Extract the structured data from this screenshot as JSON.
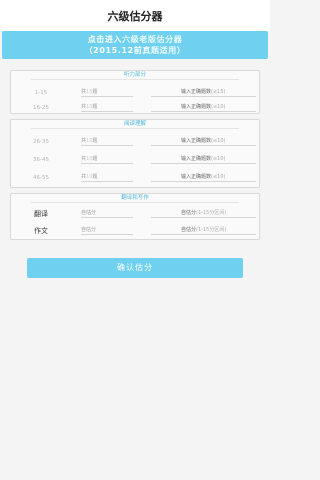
{
  "header": {
    "title": "六级估分器"
  },
  "banner": {
    "line1_highlight": "点击进入",
    "line1_plain": "六级老版估分器",
    "line2_open": "（",
    "line2_year": "2015.12前",
    "line2_plain": "真题适用",
    "line2_close": "）"
  },
  "listening": {
    "title": "听力部分",
    "rows": [
      {
        "range": "1-15",
        "count_prefix": "共",
        "count": "15",
        "count_suffix": "题",
        "input_label": "输入正确题数",
        "max": "(≤15)"
      },
      {
        "range": "16-25",
        "count_prefix": "共",
        "count": "10",
        "count_suffix": "题",
        "input_label": "输入正确题数",
        "max": "(≤10)"
      }
    ]
  },
  "reading": {
    "title": "阅读理解",
    "rows": [
      {
        "range": "26-35",
        "count_prefix": "共",
        "count": "10",
        "count_suffix": "题",
        "input_label": "输入正确题数",
        "max": "(≤10)"
      },
      {
        "range": "36-45",
        "count_prefix": "共",
        "count": "10",
        "count_suffix": "题",
        "input_label": "输入正确题数",
        "max": "(≤10)"
      },
      {
        "range": "46-55",
        "count_prefix": "共",
        "count": "10",
        "count_suffix": "题",
        "input_label": "输入正确题数",
        "max": "(≤10)"
      }
    ]
  },
  "writing": {
    "title": "翻译和写作",
    "rows": [
      {
        "label": "翻译",
        "self_label": "自估分",
        "input_label": "自估分",
        "range": "(1-15分区间)"
      },
      {
        "label": "作文",
        "self_label": "自估分",
        "input_label": "自估分",
        "range": "(1-15分区间)"
      }
    ]
  },
  "confirm_label": "确认估分",
  "colors": {
    "accent": "#6fd1ef",
    "section_title": "#4fb8dd"
  }
}
